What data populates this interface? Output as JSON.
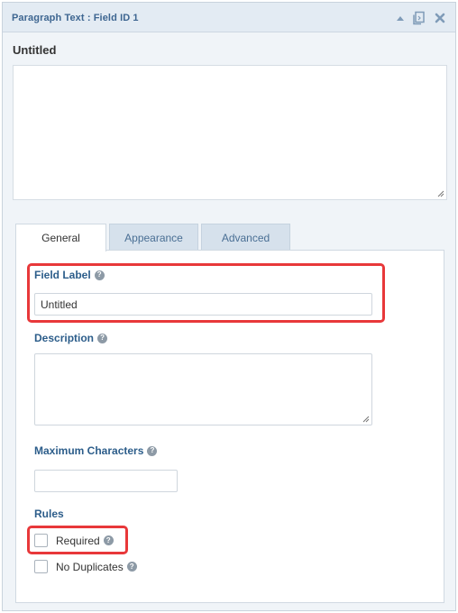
{
  "header": {
    "title": "Paragraph Text : Field ID 1",
    "icons": [
      "collapse-arrow-icon",
      "duplicate-icon",
      "close-icon"
    ]
  },
  "preview": {
    "label": "Untitled",
    "value": ""
  },
  "tabs": [
    {
      "label": "General",
      "active": true
    },
    {
      "label": "Appearance",
      "active": false
    },
    {
      "label": "Advanced",
      "active": false
    }
  ],
  "general": {
    "field_label": {
      "label": "Field Label",
      "help": "?",
      "value": "Untitled"
    },
    "description": {
      "label": "Description",
      "help": "?",
      "value": ""
    },
    "max_chars": {
      "label": "Maximum Characters",
      "help": "?",
      "value": ""
    },
    "rules": {
      "label": "Rules",
      "required": {
        "label": "Required",
        "help": "?",
        "checked": false
      },
      "no_duplicates": {
        "label": "No Duplicates",
        "help": "?",
        "checked": false
      }
    }
  },
  "colors": {
    "accent": "#2c5d8a",
    "highlight": "#e8383a",
    "tab_inactive": "#d6e1ec"
  }
}
